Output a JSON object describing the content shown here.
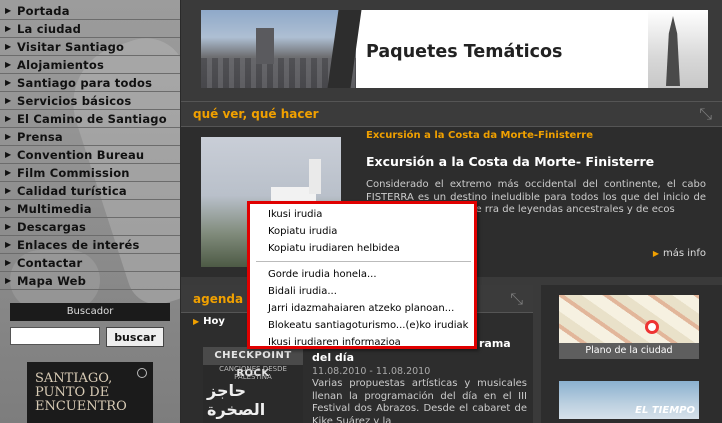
{
  "sidebar": {
    "nav_items": [
      "Portada",
      "La ciudad",
      "Visitar Santiago",
      "Alojamientos",
      "Santiago para todos",
      "Servicios básicos",
      "El Camino de Santiago",
      "Prensa",
      "Convention Bureau",
      "Film Commission",
      "Calidad turística",
      "Multimedia",
      "Descargas",
      "Enlaces de interés",
      "Contactar",
      "Mapa Web"
    ],
    "search": {
      "title": "Buscador",
      "button": "buscar",
      "placeholder": ""
    },
    "promo": {
      "line1": "SANTIAGO,",
      "line2": "PUNTO DE",
      "line3": "ENCUENTRO"
    }
  },
  "banner": {
    "title": "Paquetes Temáticos"
  },
  "que_ver": {
    "section_title": "qué ver, qué hacer",
    "kicker": "Excursión a la Costa da Morte-Finisterre",
    "heading": "Excursión a la Costa da Morte- Finisterre",
    "text": "Considerado el extremo más occidental del continente, el cabo FISTERRA es un destino ineludible para todos los que del inicio de la abrupta y fascinante rra de leyendas ancestrales y de ecos",
    "more": "más info"
  },
  "agenda": {
    "section_title": "agenda",
    "hoy": "Hoy",
    "image": {
      "band": "CHECKPOINT ROCK",
      "sub": "CANCIONES DESDE PALESTINA",
      "arabic": "حاجز الصخرة"
    },
    "title_part1": "rama",
    "title_part2": "del día",
    "date": "11.08.2010 - 11.08.2010",
    "text": "Varias propuestas artísticas y musicales llenan la programación del día en el III Festival dos Abrazos. Desde el cabaret de Kike Suárez y la"
  },
  "right_col": {
    "map_label": "Plano de la ciudad",
    "weather_label": "EL TIEMPO"
  },
  "context_menu": {
    "items": [
      "Ikusi irudia",
      "Kopiatu irudia",
      "Kopiatu irudiaren helbidea",
      "Gorde irudia honela...",
      "Bidali irudia...",
      "Jarri idazmahaiaren atzeko planoan...",
      "Blokeatu santiagoturismo...(e)ko irudiak",
      "Ikusi irudiaren informazioa"
    ]
  },
  "colors": {
    "accent": "#f0a000",
    "menu_border": "#e00000"
  }
}
